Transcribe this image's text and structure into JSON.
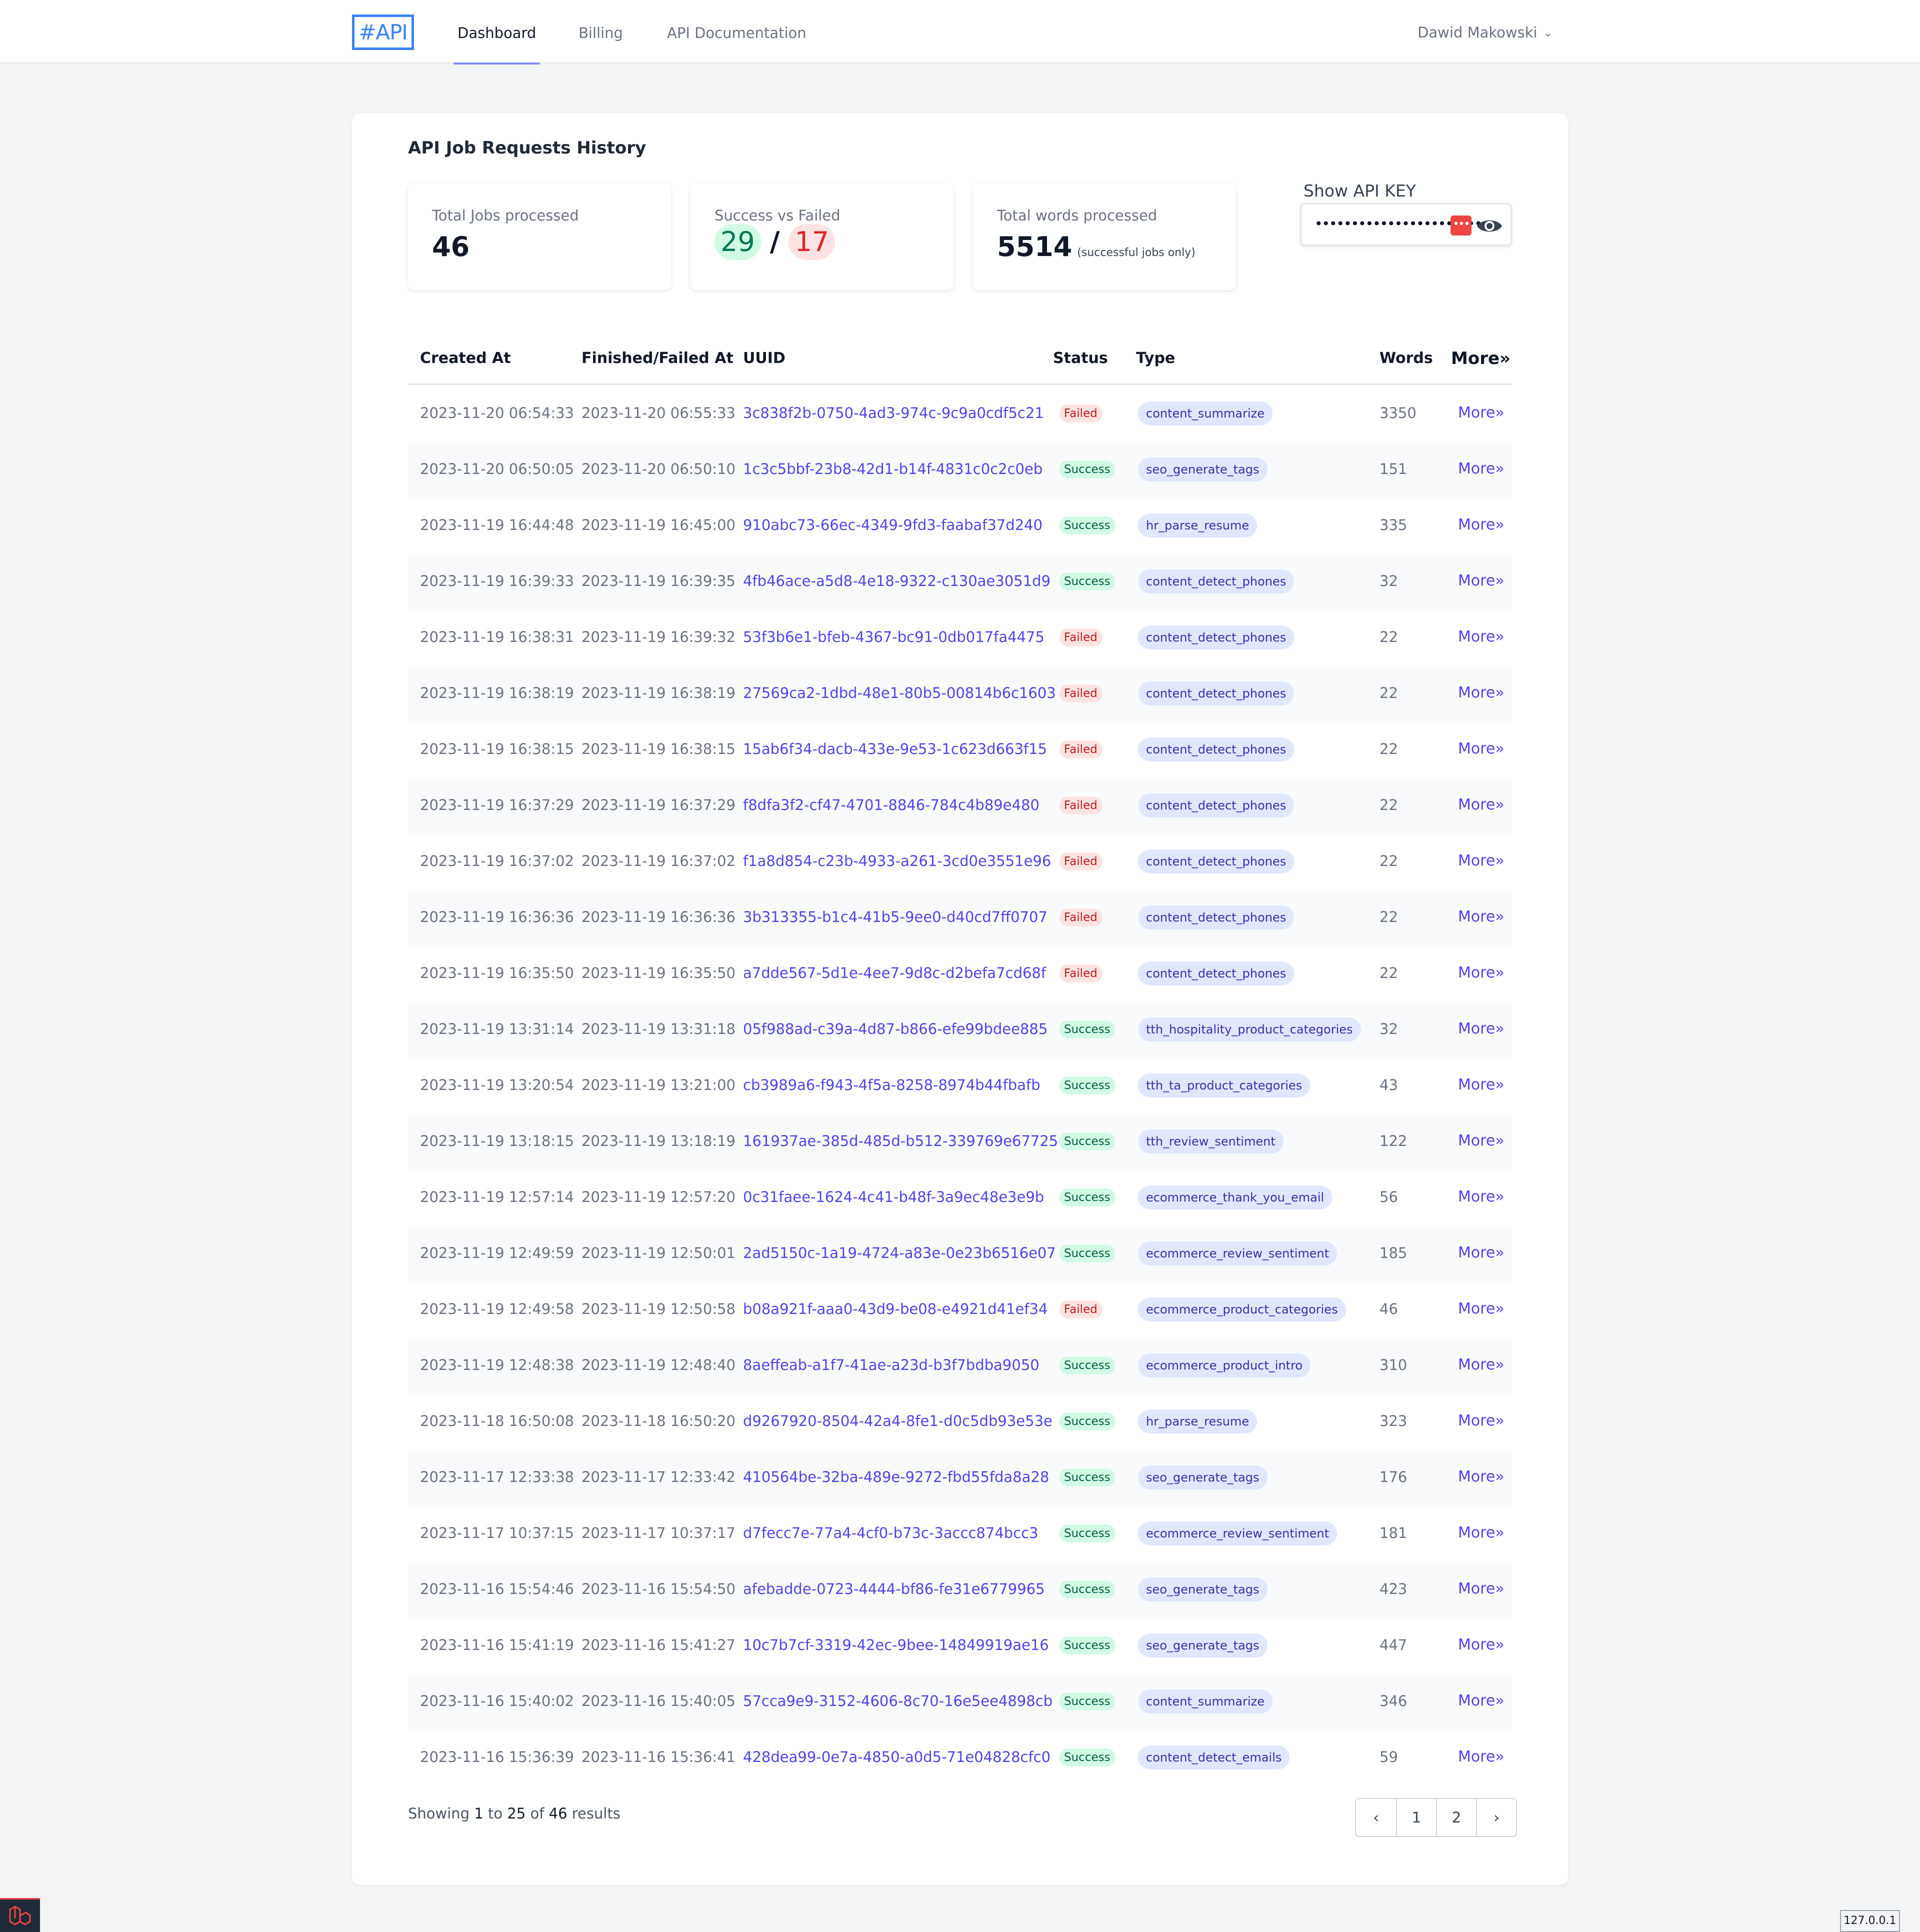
{
  "nav": {
    "logo": "#API",
    "links": [
      "Dashboard",
      "Billing",
      "API Documentation"
    ],
    "user": "Dawid Makowski"
  },
  "card": {
    "title": "API Job Requests History",
    "stats": {
      "total_jobs_label": "Total Jobs processed",
      "total_jobs_value": "46",
      "success_failed_label": "Success vs Failed",
      "success_value": "29",
      "separator": "/",
      "failed_value": "17",
      "words_label": "Total words processed",
      "words_value": "5514",
      "words_note": "(successful jobs only)"
    },
    "api_key": {
      "label": "Show API KEY",
      "masked": "•••••••••••••••••••••••",
      "badge": "•••"
    }
  },
  "table": {
    "headers": [
      "Created At",
      "Finished/Failed At",
      "UUID",
      "Status",
      "Type",
      "Words",
      "More»"
    ],
    "rows": [
      [
        "2023-11-20 06:54:33",
        "2023-11-20 06:55:33",
        "3c838f2b-0750-4ad3-974c-9c9a0cdf5c21",
        "Failed",
        "content_summarize",
        "3350",
        "More»"
      ],
      [
        "2023-11-20 06:50:05",
        "2023-11-20 06:50:10",
        "1c3c5bbf-23b8-42d1-b14f-4831c0c2c0eb",
        "Success",
        "seo_generate_tags",
        "151",
        "More»"
      ],
      [
        "2023-11-19 16:44:48",
        "2023-11-19 16:45:00",
        "910abc73-66ec-4349-9fd3-faabaf37d240",
        "Success",
        "hr_parse_resume",
        "335",
        "More»"
      ],
      [
        "2023-11-19 16:39:33",
        "2023-11-19 16:39:35",
        "4fb46ace-a5d8-4e18-9322-c130ae3051d9",
        "Success",
        "content_detect_phones",
        "32",
        "More»"
      ],
      [
        "2023-11-19 16:38:31",
        "2023-11-19 16:39:32",
        "53f3b6e1-bfeb-4367-bc91-0db017fa4475",
        "Failed",
        "content_detect_phones",
        "22",
        "More»"
      ],
      [
        "2023-11-19 16:38:19",
        "2023-11-19 16:38:19",
        "27569ca2-1dbd-48e1-80b5-00814b6c1603",
        "Failed",
        "content_detect_phones",
        "22",
        "More»"
      ],
      [
        "2023-11-19 16:38:15",
        "2023-11-19 16:38:15",
        "15ab6f34-dacb-433e-9e53-1c623d663f15",
        "Failed",
        "content_detect_phones",
        "22",
        "More»"
      ],
      [
        "2023-11-19 16:37:29",
        "2023-11-19 16:37:29",
        "f8dfa3f2-cf47-4701-8846-784c4b89e480",
        "Failed",
        "content_detect_phones",
        "22",
        "More»"
      ],
      [
        "2023-11-19 16:37:02",
        "2023-11-19 16:37:02",
        "f1a8d854-c23b-4933-a261-3cd0e3551e96",
        "Failed",
        "content_detect_phones",
        "22",
        "More»"
      ],
      [
        "2023-11-19 16:36:36",
        "2023-11-19 16:36:36",
        "3b313355-b1c4-41b5-9ee0-d40cd7ff0707",
        "Failed",
        "content_detect_phones",
        "22",
        "More»"
      ],
      [
        "2023-11-19 16:35:50",
        "2023-11-19 16:35:50",
        "a7dde567-5d1e-4ee7-9d8c-d2befa7cd68f",
        "Failed",
        "content_detect_phones",
        "22",
        "More»"
      ],
      [
        "2023-11-19 13:31:14",
        "2023-11-19 13:31:18",
        "05f988ad-c39a-4d87-b866-efe99bdee885",
        "Success",
        "tth_hospitality_product_categories",
        "32",
        "More»"
      ],
      [
        "2023-11-19 13:20:54",
        "2023-11-19 13:21:00",
        "cb3989a6-f943-4f5a-8258-8974b44fbafb",
        "Success",
        "tth_ta_product_categories",
        "43",
        "More»"
      ],
      [
        "2023-11-19 13:18:15",
        "2023-11-19 13:18:19",
        "161937ae-385d-485d-b512-339769e67725",
        "Success",
        "tth_review_sentiment",
        "122",
        "More»"
      ],
      [
        "2023-11-19 12:57:14",
        "2023-11-19 12:57:20",
        "0c31faee-1624-4c41-b48f-3a9ec48e3e9b",
        "Success",
        "ecommerce_thank_you_email",
        "56",
        "More»"
      ],
      [
        "2023-11-19 12:49:59",
        "2023-11-19 12:50:01",
        "2ad5150c-1a19-4724-a83e-0e23b6516e07",
        "Success",
        "ecommerce_review_sentiment",
        "185",
        "More»"
      ],
      [
        "2023-11-19 12:49:58",
        "2023-11-19 12:50:58",
        "b08a921f-aaa0-43d9-be08-e4921d41ef34",
        "Failed",
        "ecommerce_product_categories",
        "46",
        "More»"
      ],
      [
        "2023-11-19 12:48:38",
        "2023-11-19 12:48:40",
        "8aeffeab-a1f7-41ae-a23d-b3f7bdba9050",
        "Success",
        "ecommerce_product_intro",
        "310",
        "More»"
      ],
      [
        "2023-11-18 16:50:08",
        "2023-11-18 16:50:20",
        "d9267920-8504-42a4-8fe1-d0c5db93e53e",
        "Success",
        "hr_parse_resume",
        "323",
        "More»"
      ],
      [
        "2023-11-17 12:33:38",
        "2023-11-17 12:33:42",
        "410564be-32ba-489e-9272-fbd55fda8a28",
        "Success",
        "seo_generate_tags",
        "176",
        "More»"
      ],
      [
        "2023-11-17 10:37:15",
        "2023-11-17 10:37:17",
        "d7fecc7e-77a4-4cf0-b73c-3accc874bcc3",
        "Success",
        "ecommerce_review_sentiment",
        "181",
        "More»"
      ],
      [
        "2023-11-16 15:54:46",
        "2023-11-16 15:54:50",
        "afebadde-0723-4444-bf86-fe31e6779965",
        "Success",
        "seo_generate_tags",
        "423",
        "More»"
      ],
      [
        "2023-11-16 15:41:19",
        "2023-11-16 15:41:27",
        "10c7b7cf-3319-42ec-9bee-14849919ae16",
        "Success",
        "seo_generate_tags",
        "447",
        "More»"
      ],
      [
        "2023-11-16 15:40:02",
        "2023-11-16 15:40:05",
        "57cca9e9-3152-4606-8c70-16e5ee4898cb",
        "Success",
        "content_summarize",
        "346",
        "More»"
      ],
      [
        "2023-11-16 15:36:39",
        "2023-11-16 15:36:41",
        "428dea99-0e7a-4850-a0d5-71e04828cfc0",
        "Success",
        "content_detect_emails",
        "59",
        "More»"
      ]
    ]
  },
  "pagination": {
    "showing_prefix": "Showing",
    "from": "1",
    "to_word": "to",
    "to": "25",
    "of_word": "of",
    "total": "46",
    "results_word": "results",
    "prev": "‹",
    "pages": [
      "1",
      "2"
    ],
    "next": "›"
  },
  "debug": {
    "ip": "127.0.0.1"
  },
  "colors": {
    "accent": "#4f46e5",
    "logo": "#3b82f6",
    "success_bg": "#d1fae5",
    "failed_bg": "#fee2e2"
  }
}
